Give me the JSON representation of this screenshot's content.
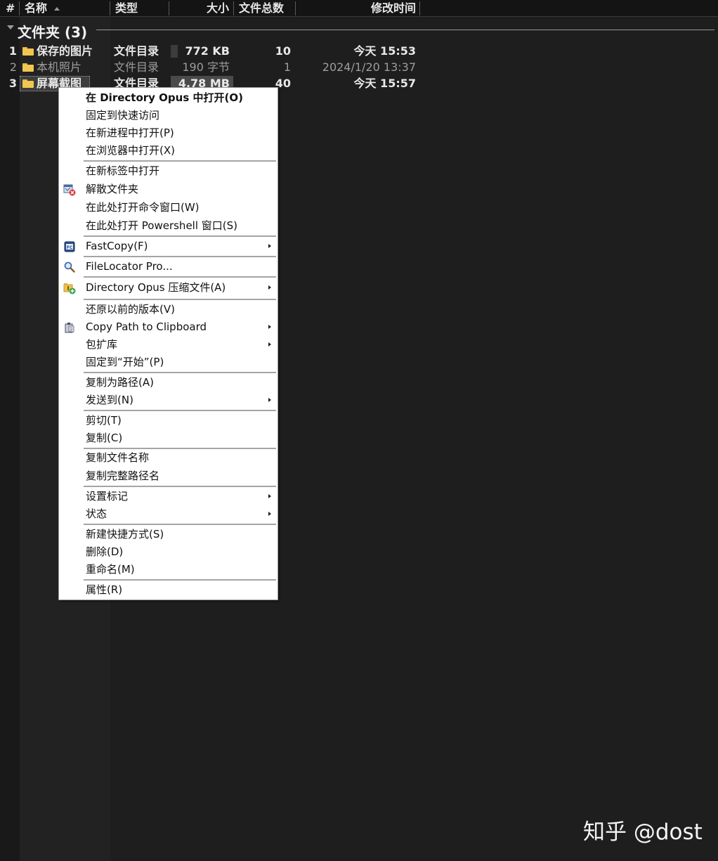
{
  "columns": {
    "num": "#",
    "name": "名称",
    "type": "类型",
    "size": "大小",
    "count": "文件总数",
    "modified": "修改时间"
  },
  "group": {
    "title": "文件夹 (3)"
  },
  "rows": [
    {
      "num": "1",
      "name": "保存的图片",
      "type": "文件目录",
      "size": "772 KB",
      "count": "10",
      "modified": "今天  15:53"
    },
    {
      "num": "2",
      "name": "本机照片",
      "type": "文件目录",
      "size": "190 字节",
      "count": "1",
      "modified": "2024/1/20  13:37"
    },
    {
      "num": "3",
      "name": "屏幕截图",
      "type": "文件目录",
      "size": "4.78 MB",
      "count": "40",
      "modified": "今天  15:57"
    }
  ],
  "context_menu": {
    "items": [
      {
        "label": "在 Directory Opus 中打开(O)",
        "bold": true
      },
      {
        "label": "固定到快速访问"
      },
      {
        "label": "在新进程中打开(P)"
      },
      {
        "label": "在浏览器中打开(X)"
      },
      {
        "label": "在新标签中打开"
      },
      {
        "label": "解散文件夹",
        "icon": "dissolve-folder-icon"
      },
      {
        "label": "在此处打开命令窗口(W)"
      },
      {
        "label": "在此处打开 Powershell 窗口(S)"
      },
      {
        "label": "FastCopy(F)",
        "icon": "fastcopy-icon",
        "submenu": true
      },
      {
        "label": "FileLocator Pro...",
        "icon": "magnifier-icon"
      },
      {
        "label": "Directory Opus 压缩文件(A)",
        "icon": "archive-folder-icon",
        "submenu": true
      },
      {
        "label": "还原以前的版本(V)"
      },
      {
        "label": "Copy Path to Clipboard",
        "icon": "clipboard-icon",
        "submenu": true
      },
      {
        "label": "包扩库",
        "submenu": true
      },
      {
        "label": "固定到“开始”(P)"
      },
      {
        "label": "复制为路径(A)"
      },
      {
        "label": "发送到(N)",
        "submenu": true
      },
      {
        "label": "剪切(T)"
      },
      {
        "label": "复制(C)"
      },
      {
        "label": "复制文件名称"
      },
      {
        "label": "复制完整路径名"
      },
      {
        "label": "设置标记",
        "submenu": true
      },
      {
        "label": "状态",
        "submenu": true
      },
      {
        "label": "新建快捷方式(S)"
      },
      {
        "label": "删除(D)"
      },
      {
        "label": "重命名(M)"
      },
      {
        "label": "属性(R)"
      }
    ]
  },
  "watermark": "知乎 @dost"
}
